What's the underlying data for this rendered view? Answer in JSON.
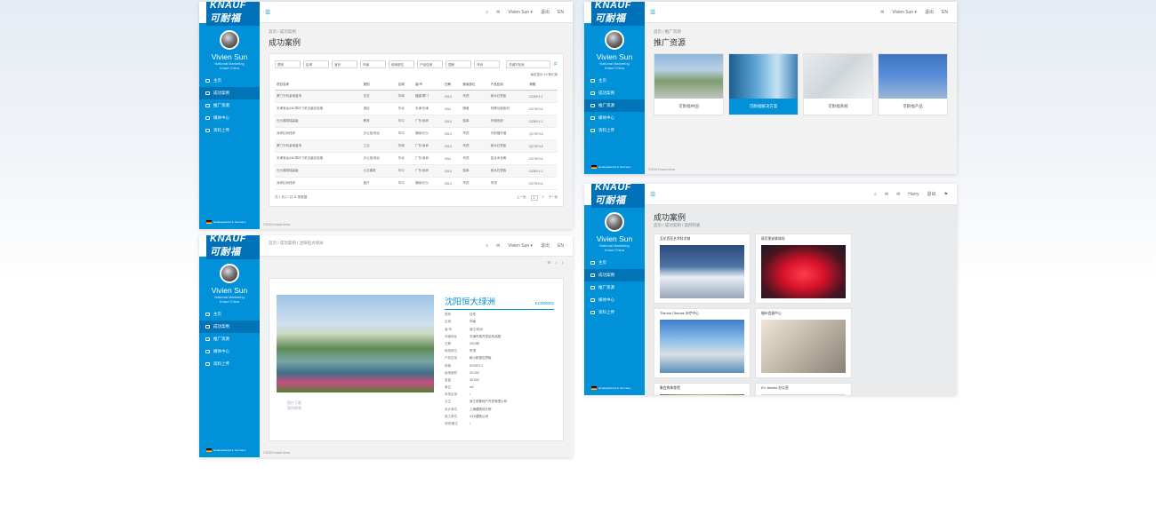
{
  "brand": {
    "logo_text": "KNAUF可耐福"
  },
  "user": {
    "name": "Vivien Sun",
    "role_line1": "National Marketing",
    "role_line2": "Knauf China"
  },
  "nav": [
    {
      "label": "主页"
    },
    {
      "label": "成功案例"
    },
    {
      "label": "推广资源"
    },
    {
      "label": "媒体中心"
    },
    {
      "label": "资料上传"
    }
  ],
  "sidebar_footer": "Headquartered in Germany",
  "topbar": {
    "menu_icon": "☰",
    "user_label": "Vivien Sun ▾",
    "logout": "退出",
    "lang": "EN",
    "user2": "Harry",
    "logout2": "退出"
  },
  "footer": "©2015 Knauf china",
  "list_page": {
    "breadcrumb": "首页 / 成功案例",
    "title": "成功案例",
    "filters": [
      "类别",
      "区域",
      "省份",
      "市级",
      "使用部位",
      "产品应用",
      "国家",
      "年份"
    ],
    "search_placeholder": "关键字检索",
    "page_size_label": "每页显示 10 条记录",
    "columns": [
      "项目名称",
      "类别",
      "区域",
      "省/市",
      "日期",
      "使用部位",
      "产品应用",
      "规格"
    ],
    "rows": [
      [
        "厦门万科金域蓝湾",
        "住宅",
        "华南",
        "福建/厦门",
        "2013",
        "吊顶",
        "耐水石膏板",
        "DC50*1.2"
      ],
      [
        "天津宝龙A3K草坪飞机无菌实验楼",
        "酒店",
        "华北",
        "天津/天津",
        "2011",
        "隔墙",
        "特殊功能板材",
        "DC75*0.6"
      ],
      [
        "长沙福禧瑞高级",
        "教育",
        "华中",
        "广东/深圳",
        "2014",
        "独库",
        "外墙系统",
        "DC50*1.2"
      ],
      [
        "深圳红树西岸",
        "办公室/商业",
        "华中",
        "湖南/长沙",
        "2013",
        "吊顶",
        "可耐福外墙",
        "QC75*0.6"
      ],
      [
        "厦门万科金域蓝湾",
        "工业",
        "华南",
        "广东/深圳",
        "2013",
        "吊顶",
        "耐水石膏板",
        "QC75*0.6"
      ],
      [
        "天津宝龙A3K草坪飞机无菌实验楼",
        "办公室/商业",
        "华北",
        "广东/深圳",
        "2011",
        "吊顶",
        "复合木龙骨",
        "DC75*0.6"
      ],
      [
        "长沙福禧瑞高级",
        "公共建筑",
        "华中",
        "广东/深圳",
        "2014",
        "独库",
        "耐水石膏板",
        "DC50*1.2"
      ],
      [
        "深圳红树西岸",
        "医疗",
        "华中",
        "湖南/长沙",
        "2013",
        "吊顶",
        "吊顶",
        "DC75*0.6"
      ]
    ],
    "pager_info": "共 1 页 1 / 共 11 条数据",
    "pager_prev": "上一页",
    "pager_page1": "1",
    "pager_page2": "2",
    "pager_next": "下一页"
  },
  "detail_page": {
    "breadcrumb": "首页 / 成功案例 / 沈阳恒大绿洲",
    "title": "沈阳恒大绿洲",
    "code": "KC000001",
    "fields": [
      [
        "类别",
        "住宅"
      ],
      [
        "区域",
        "华南"
      ],
      [
        "省/市",
        "浙江/杭州"
      ],
      [
        "详细地址",
        "天津东丽开发区西北路"
      ],
      [
        "日期",
        "2013年"
      ],
      [
        "使用部位",
        "吊顶"
      ],
      [
        "产品应用",
        "耐火耐湿石膏板"
      ],
      [
        "规格",
        "DC50*1.2"
      ],
      [
        "使用面积",
        "20,000"
      ],
      [
        "重量",
        "40,000"
      ],
      [
        "单位",
        "m2"
      ],
      [
        "系统应用",
        "/"
      ],
      [
        "业主",
        "浙江恒基地产开发有限公司"
      ],
      [
        "设计单位",
        "上海建筑设计院"
      ],
      [
        "施工单位",
        "XXX建筑公司"
      ],
      [
        "说明/备注",
        "/"
      ]
    ],
    "image_links": [
      "图片下载",
      "案例视频"
    ]
  },
  "promo_page": {
    "breadcrumb": "首页 / 推广资源",
    "title": "推广资源",
    "cards": [
      "可耐福中国",
      "可耐福解决方案",
      "可耐福系统",
      "可耐福产品"
    ]
  },
  "cases_page": {
    "title": "成功案例",
    "breadcrumb": "首页 / 成功案例 / 案例列表",
    "cards": [
      "瓦伦西亚艺术科学城",
      "慕尼黑安联球场",
      "Therme Obertas 水疗中心",
      "福州会展中心",
      "聚会购体育馆",
      "KV Jericho 办公室"
    ]
  },
  "colors": {
    "brand_blue": "#0091d9",
    "nav_active": "#0074b6"
  }
}
